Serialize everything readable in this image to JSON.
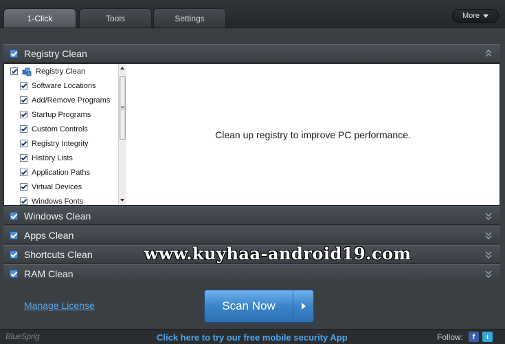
{
  "tabs": [
    {
      "label": "1-Click",
      "active": true
    },
    {
      "label": "Tools",
      "active": false
    },
    {
      "label": "Settings",
      "active": false
    }
  ],
  "more_label": "More",
  "sections": {
    "registry": {
      "label": "Registry Clean",
      "checked": true,
      "expanded": true
    },
    "windows": {
      "label": "Windows Clean",
      "checked": true
    },
    "apps": {
      "label": "Apps Clean",
      "checked": true
    },
    "shortcuts": {
      "label": "Shortcuts Clean",
      "checked": true
    },
    "ram": {
      "label": "RAM Clean",
      "checked": true
    }
  },
  "tree": {
    "root": "Registry Clean",
    "items": [
      "Software Locations",
      "Add/Remove Programs",
      "Startup Programs",
      "Custom Controls",
      "Registry Integrity",
      "History Lists",
      "Application Paths",
      "Virtual Devices",
      "Windows Fonts"
    ]
  },
  "description": "Clean up registry to improve PC performance.",
  "manage_license": "Manage License",
  "scan_button": "Scan Now",
  "footer": {
    "brand": "BlueSprig",
    "promo": "Click here to try our free mobile security App",
    "follow": "Follow:",
    "facebook_glyph": "f",
    "twitter_glyph": "t"
  },
  "watermark": "www.kuyhaa-android19.com",
  "colors": {
    "accent_blue": "#4f8fd0",
    "link_blue": "#5aa6e8",
    "background": "#3a3f44"
  }
}
